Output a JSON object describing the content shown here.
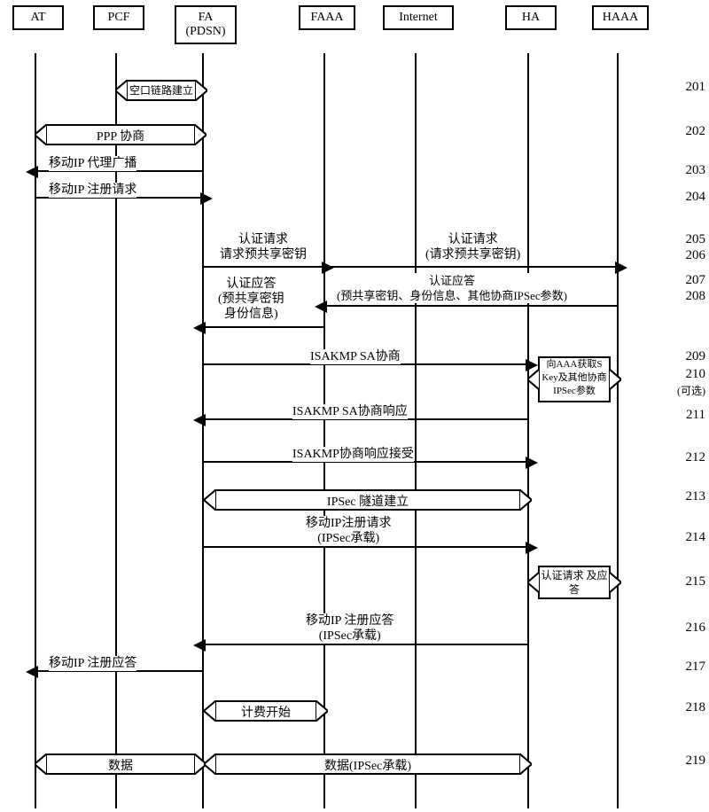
{
  "actors": {
    "at": "AT",
    "pcf": "PCF",
    "fa": "FA\n(PDSN)",
    "faaa": "FAAA",
    "internet": "Internet",
    "ha": "HA",
    "haaa": "HAAA"
  },
  "steps": {
    "s201": "201",
    "s202": "202",
    "s203": "203",
    "s204": "204",
    "s205": "205",
    "s206": "206",
    "s207": "207",
    "s208": "208",
    "s209": "209",
    "s210": "210",
    "s210opt": "(可选)",
    "s211": "211",
    "s212": "212",
    "s213": "213",
    "s214": "214",
    "s215": "215",
    "s216": "216",
    "s217": "217",
    "s218": "218",
    "s219": "219"
  },
  "labels": {
    "l201": "空口链路建立",
    "l202": "PPP 协商",
    "l203": "移动IP 代理广播",
    "l204": "移动IP 注册请求",
    "l205": "认证请求\n请求预共享密钥",
    "l206": "认证请求\n(请求预共享密钥)",
    "l207": "认证应答\n(预共享密钥、身份信息、其他协商IPSec参数)",
    "l208": "认证应答\n(预共享密钥\n身份信息)",
    "l209": "ISAKMP SA协商",
    "l210": "向AAA获取S\nKey及其他协商\nIPSec参数",
    "l211": "ISAKMP SA协商响应",
    "l212": "ISAKMP协商响应接受",
    "l213": "IPSec 隧道建立",
    "l214": "移动IP注册请求\n(IPSec承载)",
    "l215": "认证请求\n及应答",
    "l216": "移动IP 注册应答\n(IPSec承载)",
    "l217": "移动IP 注册应答",
    "l218": "计费开始",
    "l219a": "数据",
    "l219b": "数据(IPSec承载)"
  }
}
